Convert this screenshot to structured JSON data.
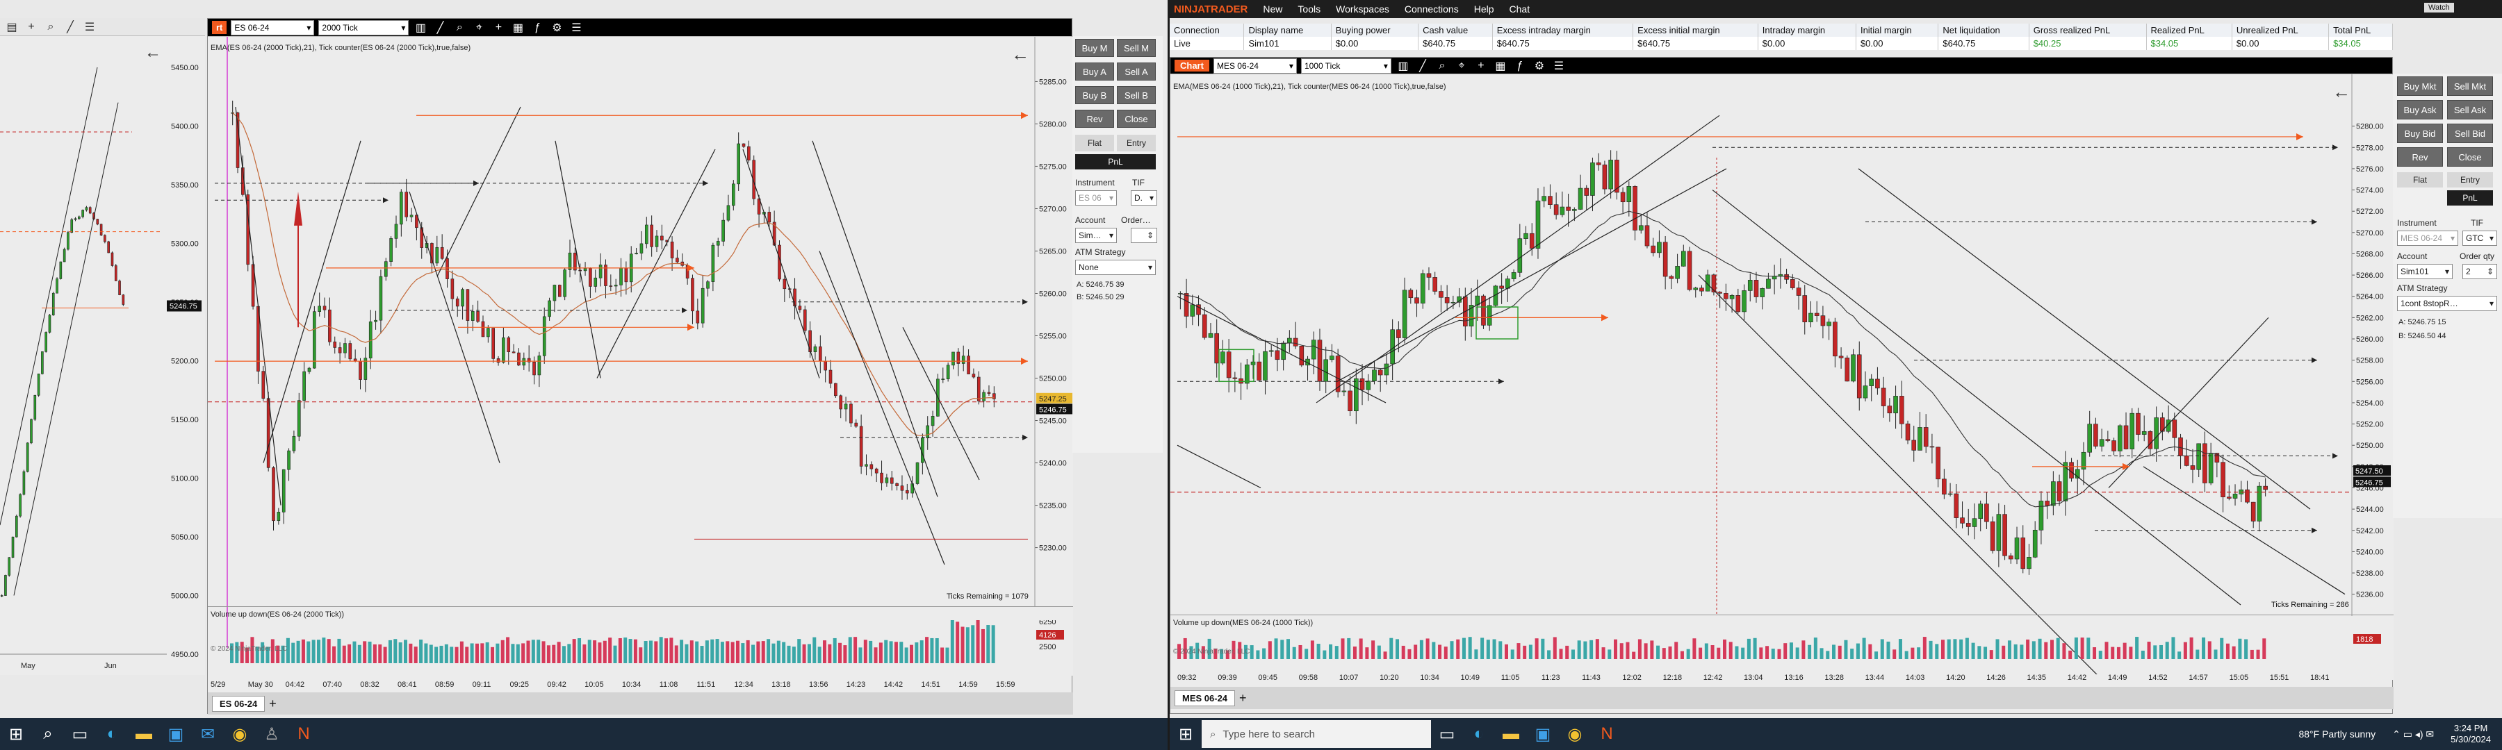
{
  "left": {
    "toolbar": {
      "instrument": "ES 06-24",
      "interval": "2000 Tick"
    },
    "small_axis_labels": [
      "5450.00",
      "5400.00",
      "5350.00",
      "5300.00",
      "5250.00",
      "5200.00",
      "5150.00",
      "5100.00",
      "5050.00",
      "5000.00",
      "4950.00"
    ],
    "small_price_tag": "5246.75",
    "small_time_labels": [
      "May",
      "Jun"
    ],
    "chart_title": "EMA(ES 06-24 (2000 Tick),21), Tick counter(ES 06-24 (2000 Tick),true,false)",
    "price_labels": [
      "5285.00",
      "5280.00",
      "5275.00",
      "5270.00",
      "5265.00",
      "5260.00",
      "5255.00",
      "5250.00",
      "5245.00",
      "5240.00",
      "5235.00",
      "5230.00"
    ],
    "price_tag_upper": "5247.25",
    "price_tag_current": "5246.75",
    "time_labels": [
      "5/29",
      "May 30",
      "04:42",
      "07:40",
      "08:32",
      "08:41",
      "08:59",
      "09:11",
      "09:25",
      "09:42",
      "10:05",
      "10:34",
      "11:08",
      "11:51",
      "12:34",
      "13:18",
      "13:56",
      "14:23",
      "14:42",
      "14:51",
      "14:59",
      "15:59"
    ],
    "ticks_remaining": "Ticks Remaining = 1079",
    "volume_title": "Volume up down(ES 06-24 (2000 Tick))",
    "volume_labels": [
      "6250",
      "4500",
      "2500"
    ],
    "volume_tag": "4126",
    "copyright": "© 2024 NinjaTrader, LLC",
    "tab": "ES 06-24",
    "order_panel": {
      "buy_mkt": "Buy M",
      "sell_mkt": "Sell M",
      "buy_ask": "Buy A",
      "sell_ask": "Sell A",
      "buy_bid": "Buy B",
      "sell_bid": "Sell B",
      "rev": "Rev",
      "close": "Close",
      "flat": "Flat",
      "entry": "Entry",
      "pnl": "PnL",
      "instrument_label": "Instrument",
      "tif_label": "TIF",
      "instrument_value": "ES 06",
      "tif_value": "D.",
      "account_label": "Account",
      "order_label": "Order…",
      "account_value": "Sim…",
      "atm_label": "ATM Strategy",
      "atm_value": "None",
      "ask": "A:  5246.75   39",
      "bid": "B:  5246.50   29"
    }
  },
  "right": {
    "title_bar": {
      "brand": "NINJATRADER",
      "menus": [
        "New",
        "Tools",
        "Workspaces",
        "Connections",
        "Help",
        "Chat"
      ],
      "watch": "Watch"
    },
    "accounts": {
      "columns": [
        "Connection",
        "Display name",
        "Buying power",
        "Cash value",
        "Excess intraday margin",
        "Excess initial margin",
        "Intraday margin",
        "Initial margin",
        "Net liquidation",
        "Gross realized PnL",
        "Realized PnL",
        "Unrealized PnL",
        "Total PnL"
      ],
      "row": [
        "Live",
        "Sim101",
        "$0.00",
        "$640.75",
        "$640.75",
        "$640.75",
        "$0.00",
        "$0.00",
        "$640.75",
        "$40.25",
        "$34.05",
        "$0.00",
        "$34.05"
      ]
    },
    "chart_tab": "Chart",
    "toolbar": {
      "instrument": "MES 06-24",
      "interval": "1000 Tick"
    },
    "chart_title": "EMA(MES 06-24 (1000 Tick),21), Tick counter(MES 06-24 (1000 Tick),true,false)",
    "price_labels": [
      "5280.00",
      "5278.00",
      "5276.00",
      "5274.00",
      "5272.00",
      "5270.00",
      "5268.00",
      "5266.00",
      "5264.00",
      "5262.00",
      "5260.00",
      "5258.00",
      "5256.00",
      "5254.00",
      "5252.00",
      "5250.00",
      "5248.00",
      "5246.00",
      "5244.00",
      "5242.00",
      "5240.00",
      "5238.00",
      "5236.00"
    ],
    "price_tag_upper": "5247.50",
    "price_tag_current": "5246.75",
    "time_labels": [
      "09:32",
      "09:39",
      "09:45",
      "09:58",
      "10:07",
      "10:20",
      "10:34",
      "10:49",
      "11:05",
      "11:23",
      "11:43",
      "12:02",
      "12:18",
      "12:42",
      "13:04",
      "13:16",
      "13:28",
      "13:44",
      "14:03",
      "14:20",
      "14:26",
      "14:35",
      "14:42",
      "14:49",
      "14:52",
      "14:57",
      "15:05",
      "15:51",
      "18:41"
    ],
    "ticks_remaining": "Ticks Remaining = 286",
    "volume_title": "Volume up down(MES 06-24 (1000 Tick))",
    "volume_tag": "1818",
    "copyright": "© 2024 NinjaTrader, LLC",
    "tab": "MES 06-24",
    "order_panel": {
      "buy_mkt": "Buy Mkt",
      "sell_mkt": "Sell Mkt",
      "buy_ask": "Buy Ask",
      "sell_ask": "Sell Ask",
      "buy_bid": "Buy Bid",
      "sell_bid": "Sell Bid",
      "rev": "Rev",
      "close": "Close",
      "flat": "Flat",
      "entry": "Entry",
      "pnl": "PnL",
      "instrument_label": "Instrument",
      "tif_label": "TIF",
      "instrument_value": "MES 06-24",
      "tif_value": "GTC",
      "account_label": "Account",
      "order_label": "Order qty",
      "account_value": "Sim101",
      "order_value": "2",
      "atm_label": "ATM Strategy",
      "atm_value": "1cont 8stopR…",
      "ask": "A:  5246.75     15",
      "bid": "B:  5246.50     44"
    }
  },
  "taskbar": {
    "search": "Type here to search",
    "weather": "88°F  Partly sunny",
    "time": "3:24 PM",
    "date": "5/30/2024"
  },
  "colors": {
    "up": "#2e9c2e",
    "down": "#c42626",
    "orange": "#f25a1e",
    "chart_bg": "#ececec"
  }
}
